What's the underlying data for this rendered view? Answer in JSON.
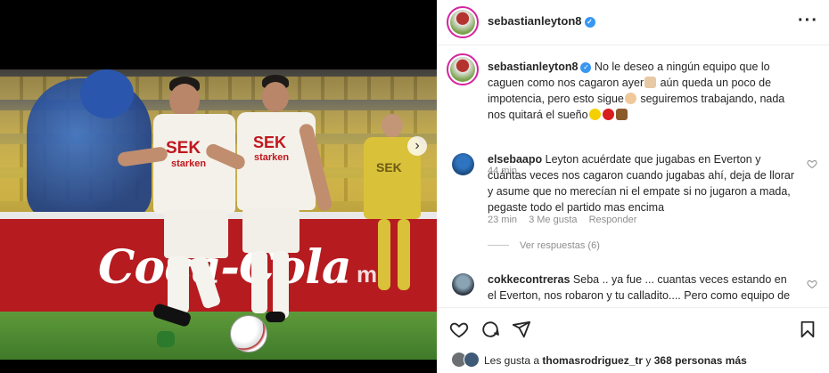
{
  "header": {
    "username": "sebastianleyton8",
    "verified_icon": "verified-badge-icon",
    "more_icon": "more-options-icon"
  },
  "photo": {
    "ad_text_main": "Coca-Cola",
    "ad_text_secondary": "mo",
    "shirt_sponsor": "SEK",
    "shirt_sub": "starken"
  },
  "caption": {
    "username": "sebastianleyton8",
    "text_1": "No le deseo a ningún equipo que lo caguen como nos cagaron ayer",
    "text_2": " aún queda un poco de impotencia, pero esto sigue",
    "text_3": " seguiremos trabajando, nada nos quitará el sueño",
    "time": "44 min"
  },
  "comments": [
    {
      "username": "elsebaapo",
      "text": "Leyton acuérdate que jugabas en Everton y cuántas veces nos cagaron cuando jugabas ahí, deja de llorar y asume que no merecían ni el empate si no jugaron a mada, pegaste todo el partido mas encima",
      "time": "23 min",
      "likes": "3 Me gusta",
      "reply": "Responder",
      "view_replies": "Ver respuestas (6)"
    },
    {
      "username": "cokkecontreras",
      "text": "Seba .. ya fue ... cuantas veces estando en el Everton, nos robaron y tu calladito.... Pero como equipo de Stgo"
    }
  ],
  "likes": {
    "prefix": "Les gusta a ",
    "user": "thomasrodriguez_tr",
    "middle": " y ",
    "count": "368 personas más"
  },
  "colors": {
    "verified": "#3897f0",
    "secondary_text": "#8e8e8e",
    "ad_red": "#b51b1f"
  }
}
